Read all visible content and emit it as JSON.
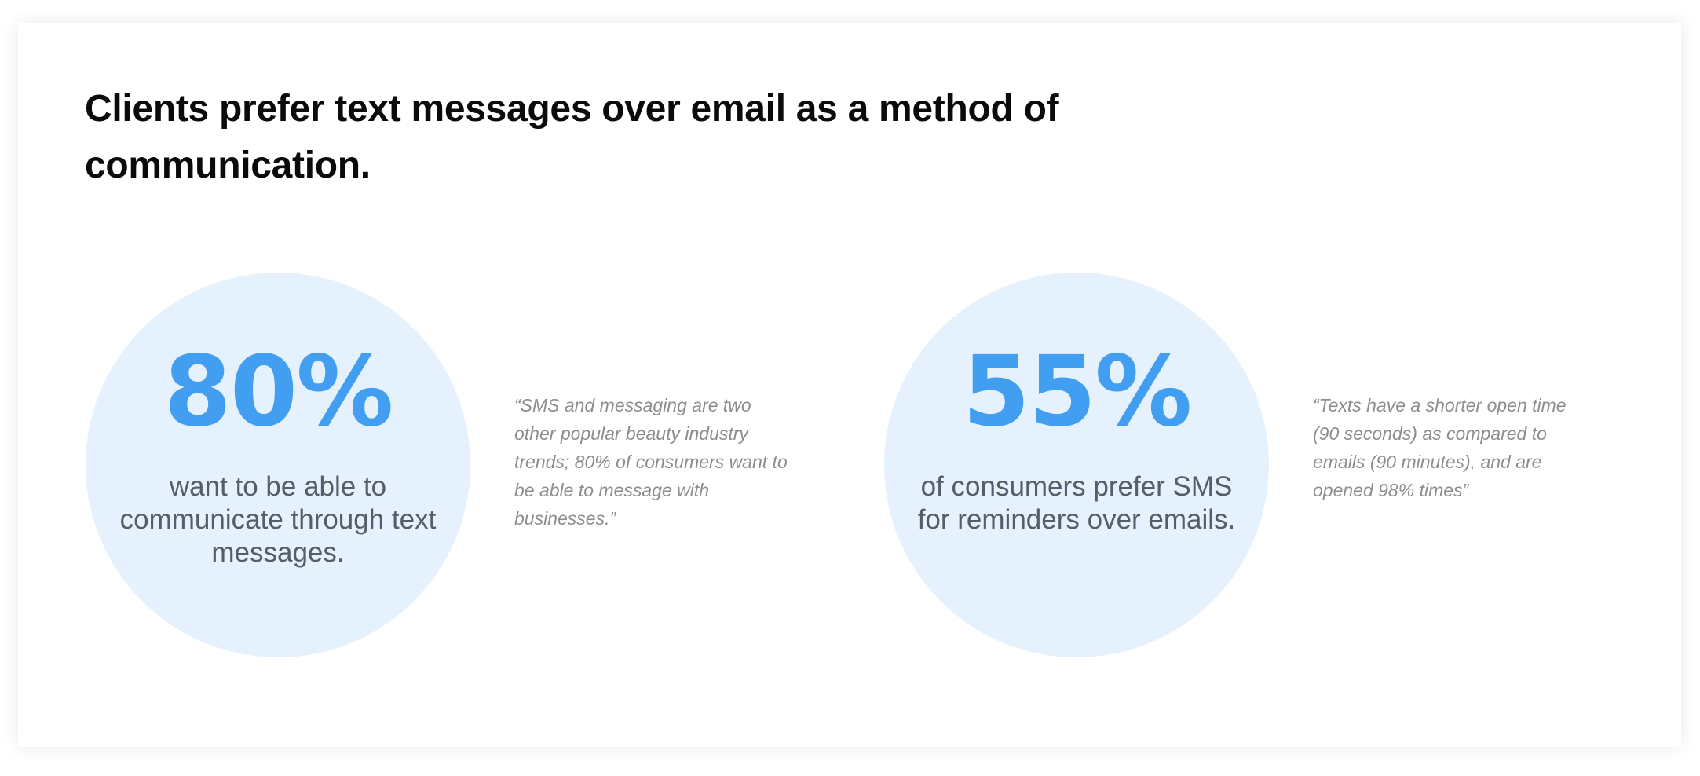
{
  "headline": "Clients prefer text messages over email as a method of communication.",
  "stats": [
    {
      "value": "80%",
      "caption": "want to be able to communicate through text messages.",
      "quote": "“SMS and messaging are two other popular beauty industry trends; 80% of consumers want to be able to message with businesses.”"
    },
    {
      "value": "55%",
      "caption": "of consumers prefer SMS for reminders over emails.",
      "quote": "“Texts have a shorter open time (90 seconds) as compared to emails (90 minutes), and are opened 98% times”"
    }
  ],
  "colors": {
    "accent": "#429ef1",
    "circle_fill": "#e5f1fc",
    "caption_text": "#555d6b",
    "quote_text": "#8d8d8d",
    "headline_text": "#0b0b0b"
  }
}
